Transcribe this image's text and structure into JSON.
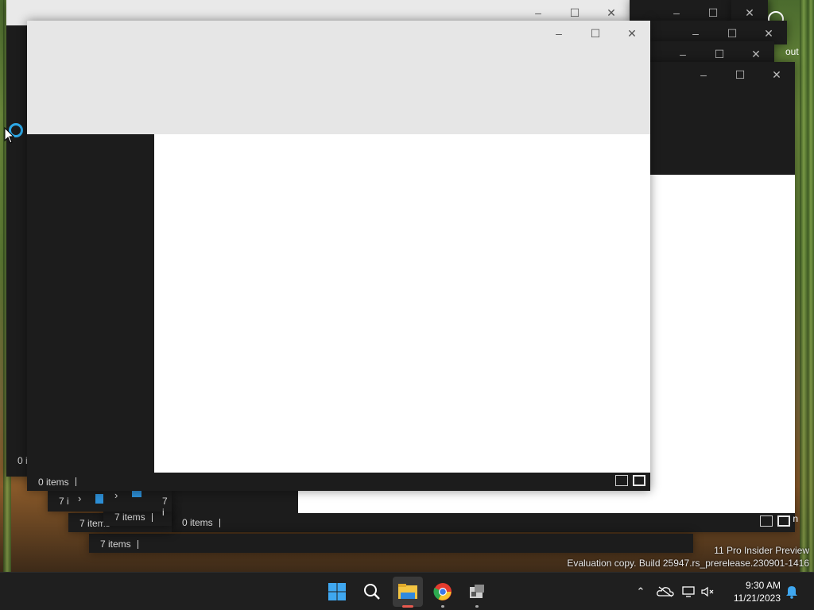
{
  "desktop": {
    "watermark_line1": "11 Pro Insider Preview",
    "watermark_line2": "Evaluation copy. Build 25947.rs_prerelease.230901-1416",
    "partial_text_top": "out",
    "partial_text_right": "n"
  },
  "windows": {
    "back_left": {
      "status_items": "0 i"
    },
    "back_1": {
      "status_items": "7 items"
    },
    "back_2": {
      "status_items": "7 items"
    },
    "back_3": {
      "status_items": "7 i"
    },
    "back_4": {
      "status_items": "7 i"
    },
    "back_right": {
      "status_items": "0 items"
    },
    "front": {
      "status_items": "0 items"
    }
  },
  "taskbar": {
    "apps": [
      "start-icon",
      "search-icon",
      "file-explorer-icon",
      "chrome-icon",
      "app-icon"
    ],
    "clock_time": "9:30 AM",
    "clock_date": "11/21/2023",
    "tray_icons": [
      "chevron-up-icon",
      "onedrive-icon",
      "network-icon",
      "volume-muted-icon",
      "notification-bell-icon"
    ]
  },
  "colors": {
    "window_dark": "#1c1c1c",
    "header_light": "#e6e6e6",
    "content_white": "#ffffff",
    "accent": "#0a84ff"
  }
}
